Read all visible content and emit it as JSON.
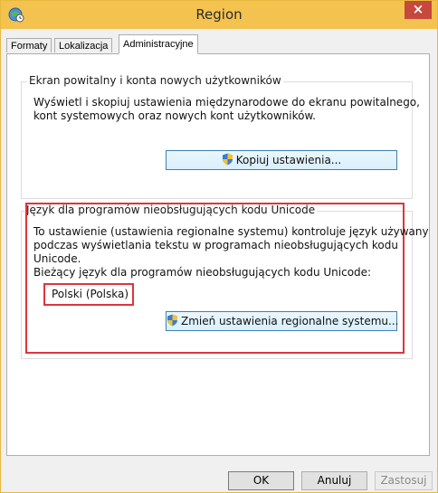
{
  "window": {
    "title": "Region",
    "close_label": "×"
  },
  "tabs": [
    {
      "label": "Formaty"
    },
    {
      "label": "Lokalizacja"
    },
    {
      "label": "Administracyjne",
      "active": true
    }
  ],
  "welcome_group": {
    "title": "Ekran powitalny i konta nowych użytkowników",
    "desc_line1": "Wyświetl i skopiuj ustawienia międzynarodowe do ekranu powitalnego,",
    "desc_line2": "kont systemowych oraz nowych kont użytkowników.",
    "copy_button": "Kopiuj ustawienia..."
  },
  "unicode_group": {
    "title": "Język dla programów nieobsługujących kodu Unicode",
    "desc_line1": "To ustawienie (ustawienia regionalne systemu) kontroluje język używany",
    "desc_line2": "podczas wyświetlania tekstu w programach nieobsługujących kodu",
    "desc_line3": "Unicode.",
    "current_label": "Bieżący język dla programów nieobsługujących kodu Unicode:",
    "current_value": "Polski (Polska)",
    "change_button": "Zmień ustawienia regionalne systemu..."
  },
  "footer": {
    "ok": "OK",
    "cancel": "Anuluj",
    "apply": "Zastosuj"
  },
  "colors": {
    "titlebar": "#f3c24f",
    "highlight": "#e0343b",
    "button_border": "#3c7fb1"
  },
  "icons": {
    "app": "globe-clock-icon",
    "shield": "uac-shield-icon"
  }
}
